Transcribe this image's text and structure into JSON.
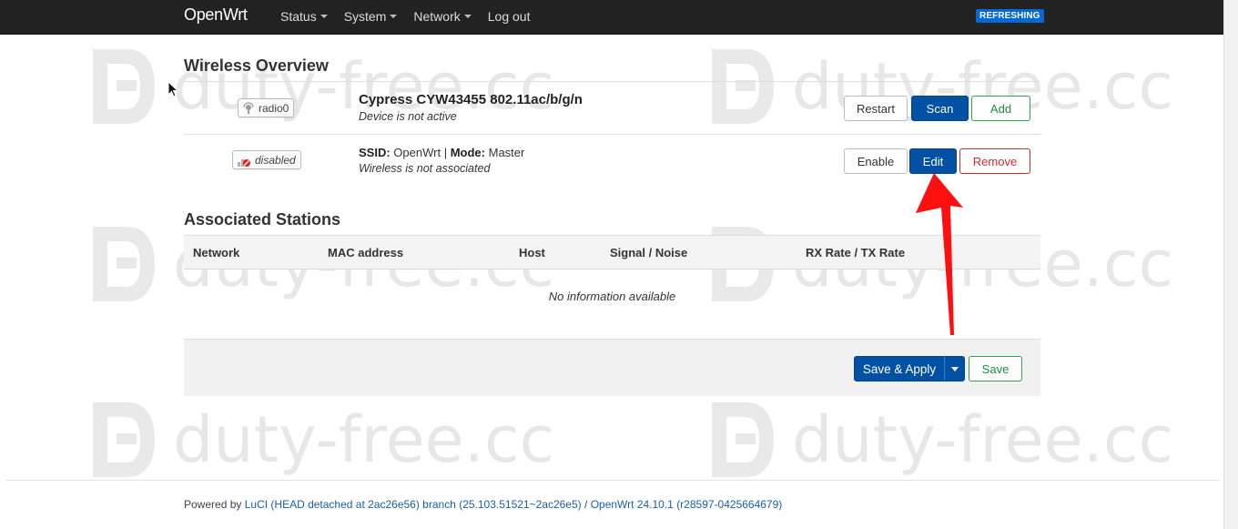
{
  "nav": {
    "brand": "OpenWrt",
    "menu": [
      {
        "label": "Status",
        "has_caret": true
      },
      {
        "label": "System",
        "has_caret": true
      },
      {
        "label": "Network",
        "has_caret": true
      },
      {
        "label": "Log out",
        "has_caret": false
      }
    ],
    "status_badge": "REFRESHING"
  },
  "wireless_overview": {
    "title": "Wireless Overview",
    "radio": {
      "badge_label": "radio0",
      "icon": "wifi-radio-icon",
      "device_name": "Cypress CYW43455 802.11ac/b/g/n",
      "device_status": "Device is not active",
      "buttons": {
        "restart": "Restart",
        "scan": "Scan",
        "add": "Add"
      }
    },
    "network": {
      "badge_label": "disabled",
      "icon": "wifi-disabled-icon",
      "ssid_key": "SSID:",
      "ssid_value": "OpenWrt",
      "separator": "|",
      "mode_key": "Mode:",
      "mode_value": "Master",
      "assoc_status": "Wireless is not associated",
      "buttons": {
        "enable": "Enable",
        "edit": "Edit",
        "remove": "Remove"
      }
    }
  },
  "associated_stations": {
    "title": "Associated Stations",
    "columns": [
      "Network",
      "MAC address",
      "Host",
      "Signal / Noise",
      "RX Rate / TX Rate"
    ],
    "empty_message": "No information available"
  },
  "page_actions": {
    "save_apply": "Save & Apply",
    "save": "Save"
  },
  "footer": {
    "prefix": "Powered by",
    "luci_link": "LuCI (HEAD detached at 2ac26e56) branch (25.103.51521~2ac26e5)",
    "separator": "/",
    "openwrt_link": "OpenWrt 24.10.1 (r28597-0425664679)"
  },
  "watermark_text": "duty-free.cc",
  "colors": {
    "navbar": "#222222",
    "primary": "#0051a3",
    "positive": "#2ea44f",
    "negative": "#c9302c",
    "annotation_arrow": "#ff0000"
  }
}
